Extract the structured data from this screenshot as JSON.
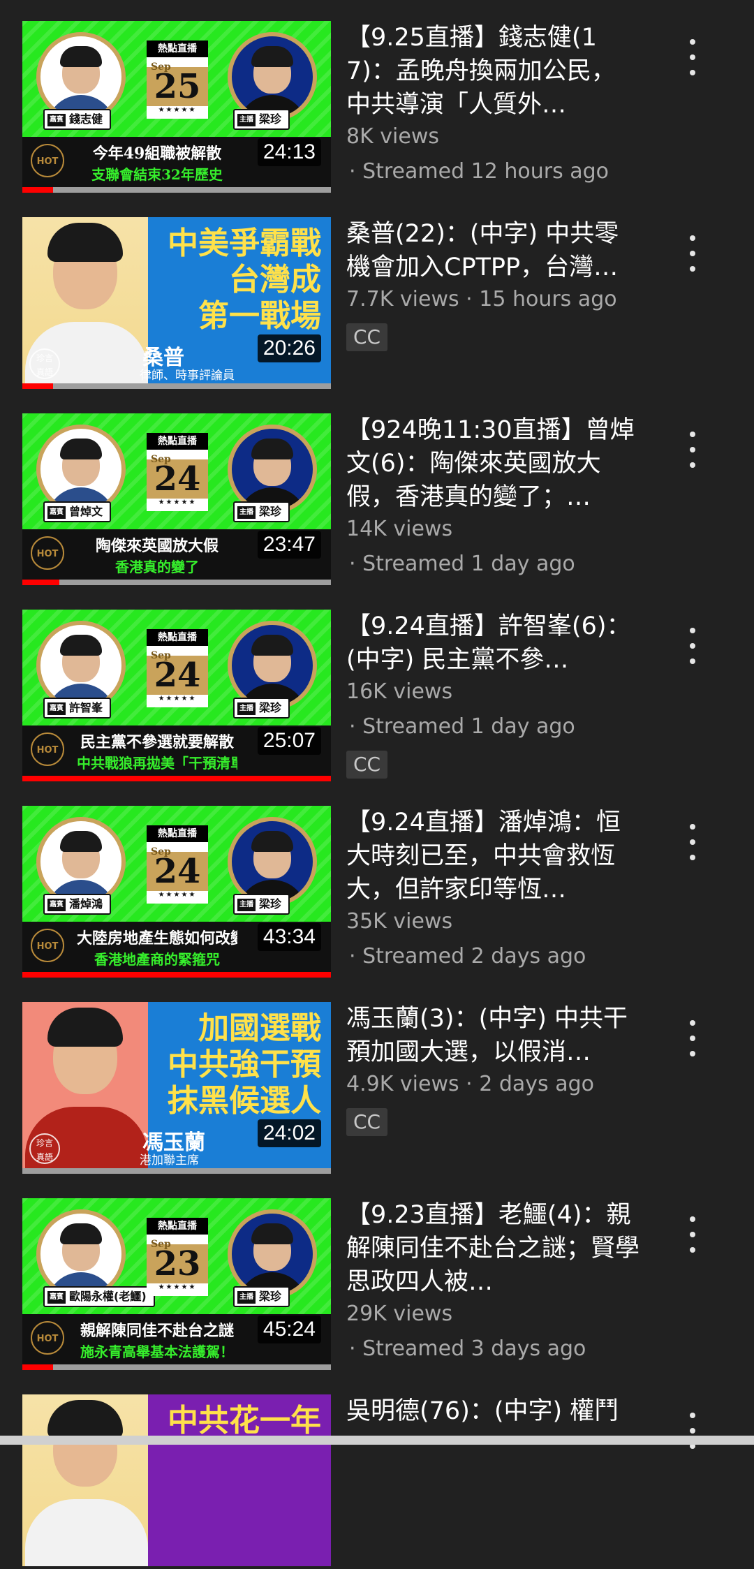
{
  "videos": [
    {
      "title": "【9.25直播】錢志健(17)：孟晚舟換兩加公民，中共導演「人質外…",
      "views": "8K views",
      "streamed": "· Streamed 12 hours ago",
      "cc": "",
      "duration": "24:13",
      "progress_pct": 10,
      "thumb": {
        "style": "live",
        "hot_live": "熱點直播",
        "month": "Sep",
        "day": "25",
        "guest_role": "嘉賓",
        "guest": "錢志健",
        "host_role": "主播",
        "host": "梁珍",
        "hot": "HOT",
        "line1": "今年49組職被解散",
        "line2": "支聯會結束32年歷史"
      }
    },
    {
      "title": "桑普(22)：(中字) 中共零機會加入CPTPP，台灣…",
      "views": "7.7K views · 15 hours ago",
      "streamed": "",
      "cc": "CC",
      "duration": "20:26",
      "progress_pct": 10,
      "thumb": {
        "style": "blue",
        "headline": "中美爭霸戰\n台灣成\n第一戰場",
        "person": "桑普",
        "person_title": "律師、時事評論員",
        "logo": "珍言\n真語"
      }
    },
    {
      "title": "【924晚11:30直播】曾焯文(6)：陶傑來英國放大假，香港真的變了；…",
      "views": "14K views",
      "streamed": "· Streamed 1 day ago",
      "cc": "",
      "duration": "23:47",
      "progress_pct": 12,
      "thumb": {
        "style": "live",
        "hot_live": "熱點直播",
        "month": "Sep",
        "day": "24",
        "guest_role": "嘉賓",
        "guest": "曾焯文",
        "host_role": "主播",
        "host": "梁珍",
        "hot": "HOT",
        "line1": "陶傑來英國放大假",
        "line2": "香港真的變了"
      }
    },
    {
      "title": "【9.24直播】許智峯(6)：(中字) 民主黨不參…",
      "views": "16K views",
      "streamed": "· Streamed 1 day ago",
      "cc": "CC",
      "duration": "25:07",
      "progress_pct": 100,
      "thumb": {
        "style": "live",
        "hot_live": "熱點直播",
        "month": "Sep",
        "day": "24",
        "guest_role": "嘉賓",
        "guest": "許智峯",
        "host_role": "主播",
        "host": "梁珍",
        "hot": "HOT",
        "line1": "民主黨不參選就要解散",
        "line2": "中共戰狼再拋美「干預清單」"
      }
    },
    {
      "title": "【9.24直播】潘焯鴻：恒大時刻已至，中共會救恆大，但許家印等恆…",
      "views": "35K views",
      "streamed": "· Streamed 2 days ago",
      "cc": "",
      "duration": "43:34",
      "progress_pct": 100,
      "thumb": {
        "style": "live",
        "hot_live": "熱點直播",
        "month": "Sep",
        "day": "24",
        "guest_role": "嘉賓",
        "guest": "潘焯鴻",
        "host_role": "主播",
        "host": "梁珍",
        "hot": "HOT",
        "line1": "大陸房地產生態如何改變",
        "line2": "香港地產商的緊箍咒"
      }
    },
    {
      "title": "馮玉蘭(3)：(中字) 中共干預加國大選，以假消…",
      "views": "4.9K views · 2 days ago",
      "streamed": "",
      "cc": "CC",
      "duration": "24:02",
      "progress_pct": 0,
      "thumb": {
        "style": "blue-red",
        "headline": "加國選戰\n中共強干預\n抹黑候選人",
        "person": "馮玉蘭",
        "person_title": "港加聯主席",
        "logo": "珍言\n真語"
      }
    },
    {
      "title": "【9.23直播】老鱷(4)：親解陳同佳不赴台之謎；賢學思政四人被…",
      "views": "29K views",
      "streamed": "· Streamed 3 days ago",
      "cc": "",
      "duration": "45:24",
      "progress_pct": 10,
      "thumb": {
        "style": "live",
        "hot_live": "熱點直播",
        "month": "Sep",
        "day": "23",
        "guest_role": "嘉賓",
        "guest": "歐陽永權(老鱷)",
        "host_role": "主播",
        "host": "梁珍",
        "hot": "HOT",
        "line1": "親解陳同佳不赴台之謎",
        "line2": "施永青高舉基本法護駕！"
      }
    },
    {
      "title": "吳明德(76)：(中字) 權鬥",
      "views": "",
      "streamed": "",
      "cc": "",
      "duration": "",
      "progress_pct": 0,
      "thumb": {
        "style": "purple",
        "headline": "中共花一年"
      }
    }
  ],
  "icons": {
    "menu": "more-vert-icon",
    "hot": "hot-badge-icon"
  },
  "colors": {
    "background": "#212121",
    "progress": "#ff0000",
    "live_green": "#27e81f",
    "gold": "#c9a35b"
  }
}
